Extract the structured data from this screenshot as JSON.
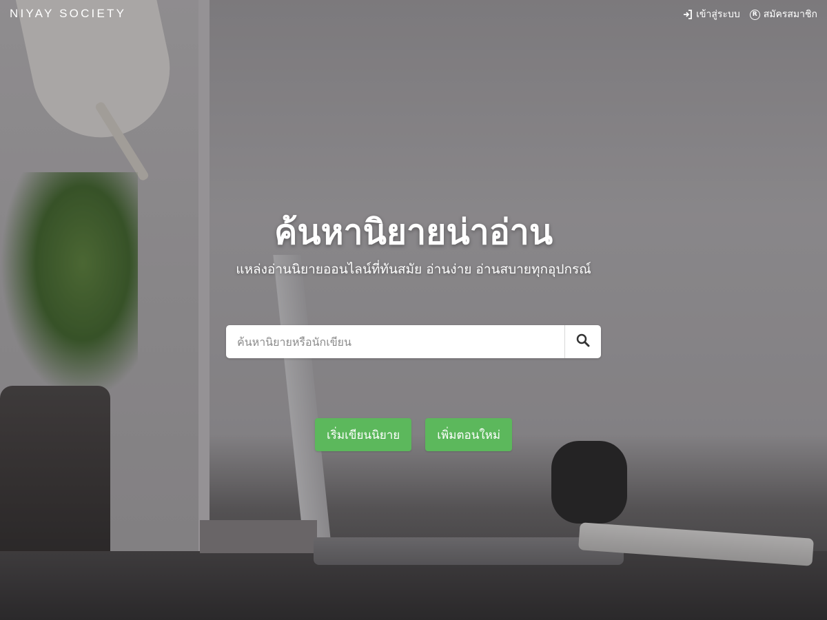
{
  "header": {
    "brand": "NIYAY SOCIETY",
    "login_label": "เข้าสู่ระบบ",
    "register_label": "สมัครสมาชิก",
    "login_icon": "sign-in-icon",
    "register_icon": "registered-icon"
  },
  "hero": {
    "title": "ค้นหานิยายน่าอ่าน",
    "subtitle": "แหล่งอ่านนิยายออนไลน์ที่ทันสมัย อ่านง่าย อ่านสบายทุกอุปกรณ์"
  },
  "search": {
    "placeholder": "ค้นหานิยายหรือนักเขียน",
    "value": "",
    "button_icon": "search-icon"
  },
  "actions": {
    "start_writing": "เริ่มเขียนนิยาย",
    "add_chapter": "เพิ่มตอนใหม่"
  },
  "colors": {
    "button_green": "#5cb85c",
    "text": "#ffffff"
  }
}
